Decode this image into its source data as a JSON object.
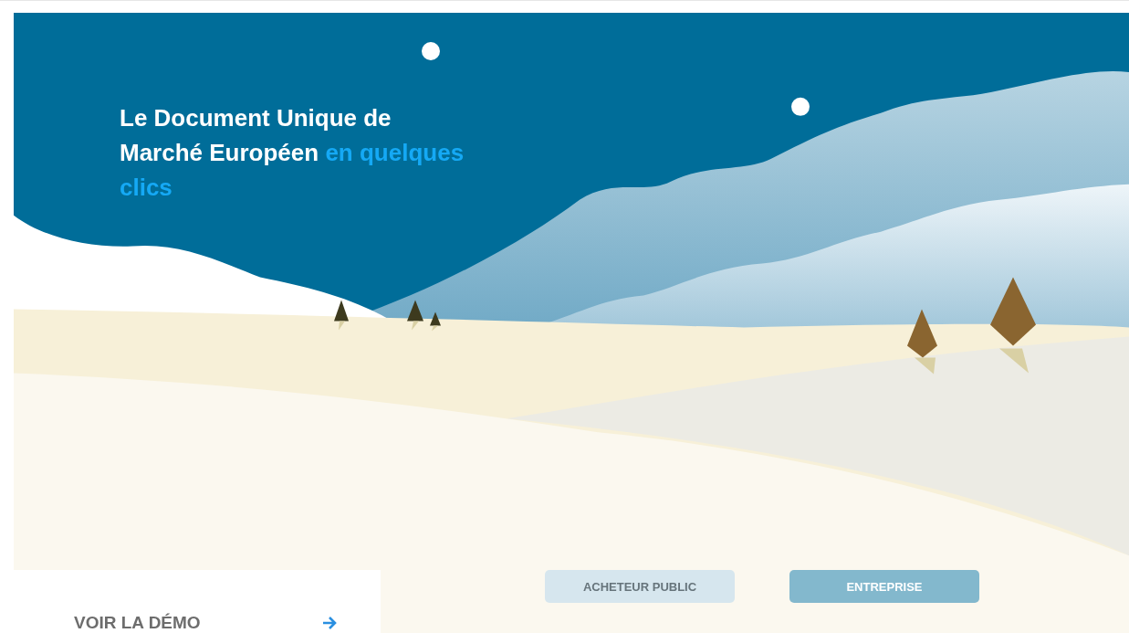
{
  "hero": {
    "title": "Le Document Unique de Marché Européen",
    "title_highlight": "en quelques clics"
  },
  "demo": {
    "label": "VOIR LA DÉMO"
  },
  "profiles": [
    {
      "label": "ACHETEUR PUBLIC",
      "selected": false
    },
    {
      "label": "ENTREPRISE",
      "selected": true
    }
  ]
}
